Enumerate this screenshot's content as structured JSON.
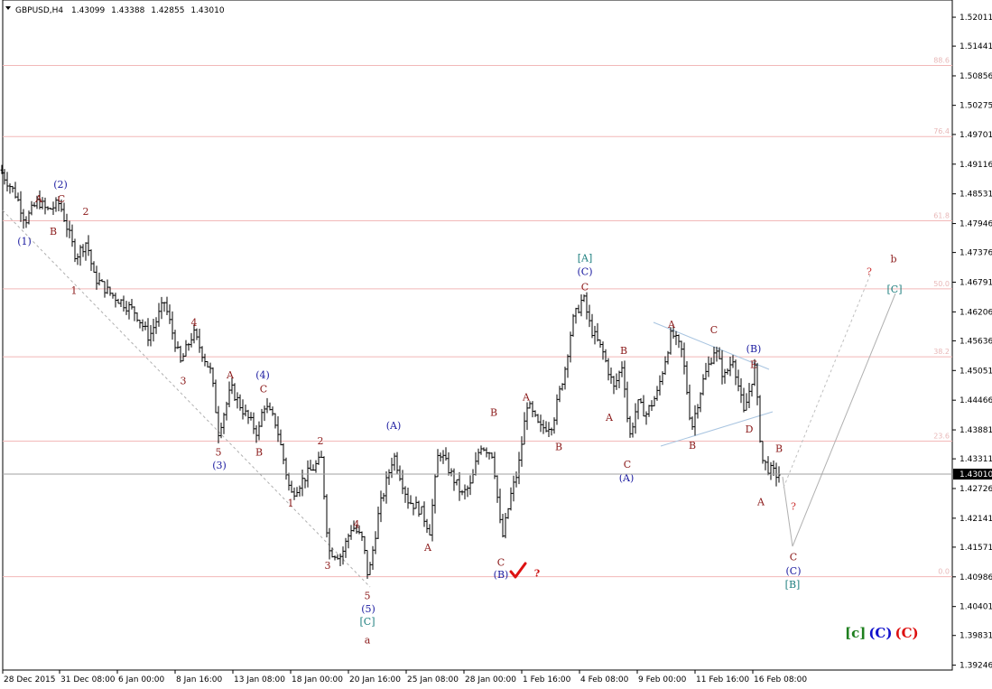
{
  "header": {
    "symbol": "GBPUSD,H4",
    "open": "1.43099",
    "high": "1.43388",
    "low": "1.42855",
    "close": "1.43010"
  },
  "current_price_label": "1.43010",
  "chart_data": {
    "type": "ohlc",
    "symbol": "GBPUSD",
    "timeframe": "H4",
    "y_ticks": [
      "1.52011",
      "1.51441",
      "1.50856",
      "1.50275",
      "1.49701",
      "1.49116",
      "1.48531",
      "1.47946",
      "1.47376",
      "1.46791",
      "1.46206",
      "1.45636",
      "1.45051",
      "1.44466",
      "1.43881",
      "1.43311",
      "1.42726",
      "1.42141",
      "1.41571",
      "1.40986",
      "1.40401",
      "1.39831",
      "1.39246"
    ],
    "ylim": [
      1.3915,
      1.5235
    ],
    "x_ticks": [
      "28 Dec 2015",
      "31 Dec 08:00",
      "6 Jan 00:00",
      "8 Jan 16:00",
      "13 Jan 08:00",
      "18 Jan 00:00",
      "20 Jan 16:00",
      "25 Jan 08:00",
      "28 Jan 00:00",
      "1 Feb 16:00",
      "4 Feb 08:00",
      "9 Feb 00:00",
      "11 Feb 16:00",
      "16 Feb 08:00"
    ],
    "fib_levels": [
      {
        "label": "88.6",
        "price": 1.5106
      },
      {
        "label": "76.4",
        "price": 1.4966
      },
      {
        "label": "61.8",
        "price": 1.48
      },
      {
        "label": "50.0",
        "price": 1.4666
      },
      {
        "label": "38.2",
        "price": 1.4532
      },
      {
        "label": "23.6",
        "price": 1.4366
      },
      {
        "label": "0.0",
        "price": 1.4099
      }
    ],
    "current_price": 1.4301,
    "close_path": [
      [
        0,
        1.49
      ],
      [
        18,
        1.485
      ],
      [
        28,
        1.48
      ],
      [
        42,
        1.484
      ],
      [
        52,
        1.482
      ],
      [
        66,
        1.4835
      ],
      [
        84,
        1.473
      ],
      [
        96,
        1.476
      ],
      [
        104,
        1.469
      ],
      [
        120,
        1.466
      ],
      [
        150,
        1.462
      ],
      [
        165,
        1.457
      ],
      [
        182,
        1.464
      ],
      [
        200,
        1.452
      ],
      [
        214,
        1.458
      ],
      [
        234,
        1.45
      ],
      [
        242,
        1.4385
      ],
      [
        256,
        1.447
      ],
      [
        268,
        1.443
      ],
      [
        286,
        1.438
      ],
      [
        292,
        1.444
      ],
      [
        306,
        1.44
      ],
      [
        322,
        1.426
      ],
      [
        340,
        1.43
      ],
      [
        356,
        1.433
      ],
      [
        364,
        1.415
      ],
      [
        378,
        1.414
      ],
      [
        390,
        1.42
      ],
      [
        402,
        1.417
      ],
      [
        408,
        1.4095
      ],
      [
        420,
        1.423
      ],
      [
        436,
        1.434
      ],
      [
        452,
        1.425
      ],
      [
        466,
        1.423
      ],
      [
        476,
        1.419
      ],
      [
        486,
        1.435
      ],
      [
        500,
        1.43
      ],
      [
        512,
        1.426
      ],
      [
        522,
        1.428
      ],
      [
        532,
        1.436
      ],
      [
        546,
        1.434
      ],
      [
        556,
        1.417
      ],
      [
        566,
        1.426
      ],
      [
        574,
        1.431
      ],
      [
        584,
        1.444
      ],
      [
        598,
        1.439
      ],
      [
        612,
        1.44
      ],
      [
        626,
        1.451
      ],
      [
        634,
        1.46
      ],
      [
        646,
        1.465
      ],
      [
        654,
        1.459
      ],
      [
        668,
        1.454
      ],
      [
        680,
        1.447
      ],
      [
        690,
        1.452
      ],
      [
        697,
        1.437
      ],
      [
        706,
        1.444
      ],
      [
        716,
        1.442
      ],
      [
        728,
        1.446
      ],
      [
        744,
        1.458
      ],
      [
        756,
        1.454
      ],
      [
        766,
        1.439
      ],
      [
        778,
        1.448
      ],
      [
        792,
        1.455
      ],
      [
        802,
        1.449
      ],
      [
        812,
        1.453
      ],
      [
        824,
        1.442
      ],
      [
        836,
        1.451
      ],
      [
        844,
        1.433
      ],
      [
        852,
        1.431
      ],
      [
        860,
        1.43
      ],
      [
        864,
        1.4301
      ]
    ],
    "annotations": [
      {
        "text": "A",
        "x": 43,
        "price": 1.4844,
        "color": "#8b1a1a"
      },
      {
        "text": "(2)",
        "x": 67,
        "price": 1.4872,
        "color": "#1a1aa0"
      },
      {
        "text": "C",
        "x": 68,
        "price": 1.4844,
        "color": "#8b1a1a"
      },
      {
        "text": "2",
        "x": 95,
        "price": 1.4819,
        "color": "#8b1a1a"
      },
      {
        "text": "B",
        "x": 59,
        "price": 1.478,
        "color": "#8b1a1a"
      },
      {
        "text": "(1)",
        "x": 27,
        "price": 1.476,
        "color": "#1a1aa0"
      },
      {
        "text": "1",
        "x": 82,
        "price": 1.4663,
        "color": "#8b1a1a"
      },
      {
        "text": "4",
        "x": 215,
        "price": 1.46,
        "color": "#8b1a1a"
      },
      {
        "text": "3",
        "x": 203,
        "price": 1.4485,
        "color": "#8b1a1a"
      },
      {
        "text": "A",
        "x": 255,
        "price": 1.4497,
        "color": "#8b1a1a"
      },
      {
        "text": "(4)",
        "x": 291,
        "price": 1.4497,
        "color": "#1a1aa0"
      },
      {
        "text": "C",
        "x": 292,
        "price": 1.4469,
        "color": "#8b1a1a"
      },
      {
        "text": "5",
        "x": 242,
        "price": 1.4345,
        "color": "#8b1a1a"
      },
      {
        "text": "(3)",
        "x": 243,
        "price": 1.4319,
        "color": "#1a1aa0"
      },
      {
        "text": "B",
        "x": 287,
        "price": 1.4345,
        "color": "#8b1a1a"
      },
      {
        "text": "2",
        "x": 355,
        "price": 1.4367,
        "color": "#8b1a1a"
      },
      {
        "text": "1",
        "x": 322,
        "price": 1.4244,
        "color": "#8b1a1a"
      },
      {
        "text": "4",
        "x": 395,
        "price": 1.4202,
        "color": "#8b1a1a"
      },
      {
        "text": "3",
        "x": 363,
        "price": 1.4121,
        "color": "#8b1a1a"
      },
      {
        "text": "5",
        "x": 407,
        "price": 1.4062,
        "color": "#8b1a1a"
      },
      {
        "text": "(5)",
        "x": 408,
        "price": 1.4036,
        "color": "#1a1aa0"
      },
      {
        "text": "[C]",
        "x": 407,
        "price": 1.4011,
        "color": "#1e7f7f"
      },
      {
        "text": "a",
        "x": 407,
        "price": 1.3975,
        "color": "#8b1a1a",
        "size": 16
      },
      {
        "text": "(A)",
        "x": 436,
        "price": 1.4397,
        "color": "#1a1aa0"
      },
      {
        "text": "A",
        "x": 474,
        "price": 1.4157,
        "color": "#8b1a1a"
      },
      {
        "text": "B",
        "x": 547,
        "price": 1.4423,
        "color": "#8b1a1a"
      },
      {
        "text": "C",
        "x": 555,
        "price": 1.4128,
        "color": "#8b1a1a"
      },
      {
        "text": "(B)",
        "x": 555,
        "price": 1.4104,
        "color": "#1a1aa0"
      },
      {
        "text": "?",
        "x": 595,
        "price": 1.4106,
        "color": "#cc1111",
        "bold": true,
        "size": 14
      },
      {
        "text": "A",
        "x": 583,
        "price": 1.4453,
        "color": "#8b1a1a"
      },
      {
        "text": "B",
        "x": 619,
        "price": 1.4355,
        "color": "#8b1a1a"
      },
      {
        "text": "[A]",
        "x": 648,
        "price": 1.4727,
        "color": "#1e7f7f"
      },
      {
        "text": "(C)",
        "x": 648,
        "price": 1.47,
        "color": "#1a1aa0"
      },
      {
        "text": "C",
        "x": 648,
        "price": 1.467,
        "color": "#8b1a1a"
      },
      {
        "text": "B",
        "x": 691,
        "price": 1.4545,
        "color": "#8b1a1a"
      },
      {
        "text": "A",
        "x": 675,
        "price": 1.4413,
        "color": "#8b1a1a"
      },
      {
        "text": "C",
        "x": 695,
        "price": 1.4321,
        "color": "#8b1a1a"
      },
      {
        "text": "(A)",
        "x": 694,
        "price": 1.4294,
        "color": "#1a1aa0"
      },
      {
        "text": "A",
        "x": 744,
        "price": 1.4596,
        "color": "#8b1a1a"
      },
      {
        "text": "C",
        "x": 791,
        "price": 1.4586,
        "color": "#8b1a1a"
      },
      {
        "text": "(B)",
        "x": 835,
        "price": 1.4548,
        "color": "#1a1aa0"
      },
      {
        "text": "E",
        "x": 835,
        "price": 1.4517,
        "color": "#8b1a1a"
      },
      {
        "text": "B",
        "x": 767,
        "price": 1.4358,
        "color": "#8b1a1a"
      },
      {
        "text": "D",
        "x": 830,
        "price": 1.439,
        "color": "#8b1a1a"
      },
      {
        "text": "B",
        "x": 863,
        "price": 1.4352,
        "color": "#8b1a1a"
      },
      {
        "text": "A",
        "x": 843,
        "price": 1.4247,
        "color": "#8b1a1a"
      },
      {
        "text": "?",
        "x": 879,
        "price": 1.4238,
        "color": "#cc3333"
      },
      {
        "text": "C",
        "x": 879,
        "price": 1.4138,
        "color": "#8b1a1a"
      },
      {
        "text": "(C)",
        "x": 879,
        "price": 1.4111,
        "color": "#1a1aa0"
      },
      {
        "text": "[B]",
        "x": 878,
        "price": 1.4084,
        "color": "#1e7f7f"
      },
      {
        "text": "b",
        "x": 990,
        "price": 1.4725,
        "color": "#8b1a1a",
        "size": 16
      },
      {
        "text": "?",
        "x": 963,
        "price": 1.47,
        "color": "#cc3333"
      },
      {
        "text": "[C]",
        "x": 991,
        "price": 1.4666,
        "color": "#1e7f7f"
      }
    ],
    "legend": [
      {
        "text": "[c]",
        "color": "#1e7f1e"
      },
      {
        "text": "(C)",
        "color": "#1111cc"
      },
      {
        "text": "(C)",
        "color": "#dd1111"
      }
    ],
    "grid": false
  }
}
